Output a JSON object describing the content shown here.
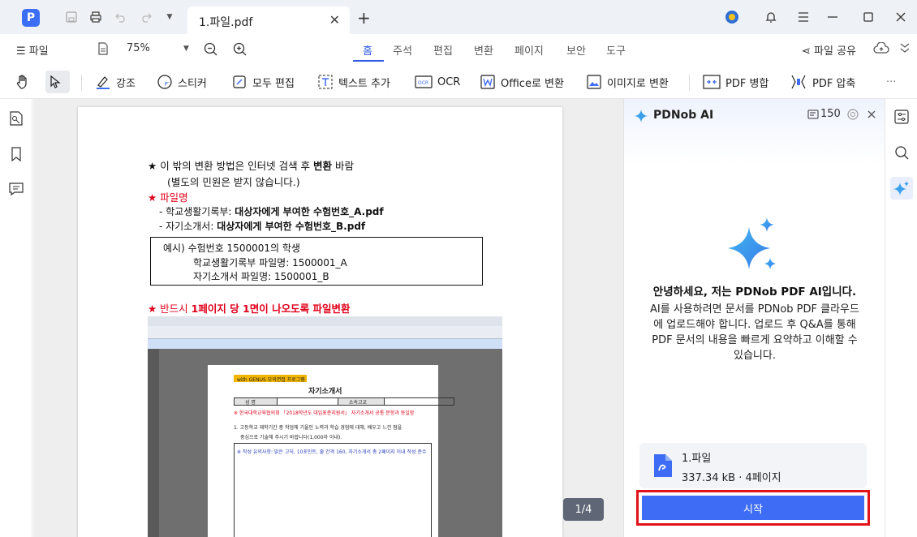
{
  "titlebar": {
    "tab_name": "1.파일.pdf",
    "new_tab": "+"
  },
  "menubar": {
    "file_menu": "파일",
    "zoom": "75%",
    "tabs": [
      "홈",
      "주석",
      "편집",
      "변환",
      "페이지",
      "보안",
      "도구"
    ],
    "active_tab": "홈",
    "share": "파일 공유"
  },
  "toolbar": {
    "highlight": "강조",
    "sticker": "스티커",
    "edit_all": "모두 편집",
    "add_text": "텍스트 추가",
    "ocr": "OCR",
    "to_office": "Office로 변환",
    "to_image": "이미지로 변환",
    "merge": "PDF 병합",
    "compress": "PDF 압축",
    "more": "···"
  },
  "document": {
    "line1_star": "★",
    "line1a": "이 밖의 변환 방법은 인터넷 검색 후 ",
    "line1b": "변환",
    "line1c": " 바람",
    "line2": "(별도의 민원은 받지 않습니다.)",
    "line3": "★ 파일명",
    "line4a": "- 학교생활기록부: ",
    "line4b": "대상자에게 부여한 수험번호_A.pdf",
    "line5a": "- 자기소개서: ",
    "line5b": "대상자에게 부여한 수험번호_B.pdf",
    "example1": "예시) 수험번호 1500001의 학생",
    "example2": "학교생활기록부 파일명: 1500001_A",
    "example3": "자기소개서 파일명: 1500001_B",
    "line6a": "★ 반드시 ",
    "line6b": "1페이지 당 1면이 나오도록 파일변환",
    "inner_badge": "with GENUS 모의면접 프로그램",
    "inner_title": "자기소개서",
    "inner_col1": "성 명",
    "inner_col2": "소속고교",
    "inner_red": "※ 한국대학교육협의회 「2018학년도 대입표준지원서」 자기소개서 공통 문항과 동일함",
    "inner_q1": "1. 고등학교 재학기간 중 학업에 기울인 노력과 학습 경험에 대해, 배우고 느낀 점을",
    "inner_q1b": "중심으로 기술해 주시기 바랍니다(1,000자 이내).",
    "inner_note": "※ 작성 유의사항: 맑은 고딕, 10포인트, 줄 간격 160, 자기소개서 총 2페이지 이내 작성 준수",
    "page_indicator": "1/4"
  },
  "ai_panel": {
    "title": "PDNob AI",
    "credits": "150",
    "heading": "안녕하세요, 저는 PDNob PDF AI입니다.",
    "description": "AI를 사용하려면 문서를 PDNob PDF 클라우드에 업로드해야 합니다. 업로드 후 Q&A를 통해 PDF 문서의 내용을 빠르게 요약하고 이해할 수 있습니다.",
    "file_name": "1.파일",
    "file_meta": "337.34 kB · 4페이지",
    "start_button": "시작"
  },
  "colors": {
    "accent": "#3e6cf4",
    "highlight_border": "#e2131a",
    "red_text": "#e0001a"
  }
}
